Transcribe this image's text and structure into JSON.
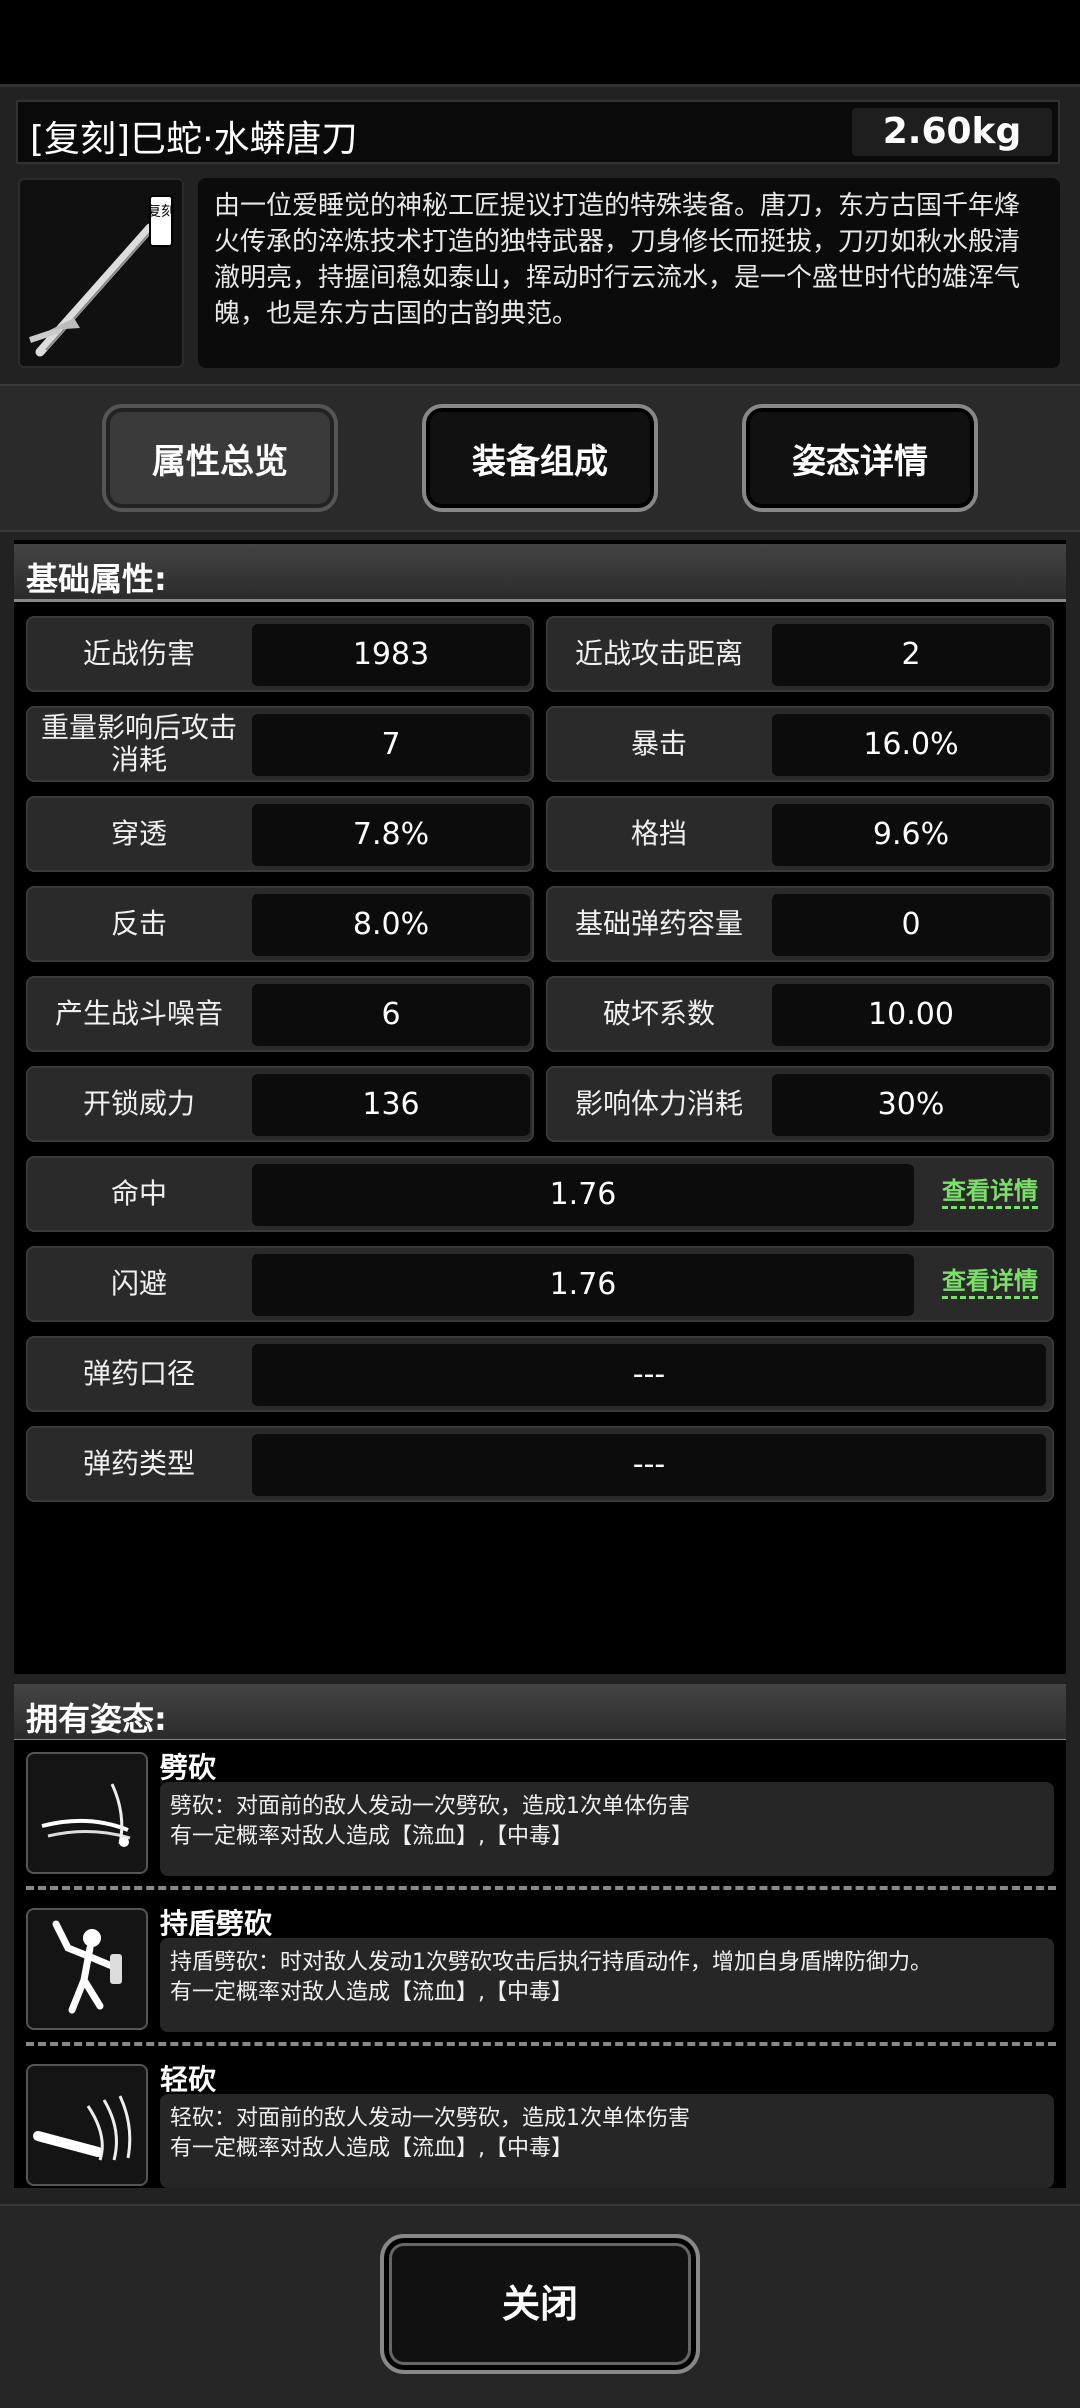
{
  "item": {
    "name": "[复刻]巳蛇·水蟒唐刀",
    "weight": "2.60kg",
    "badge": "复刻",
    "description": "由一位爱睡觉的神秘工匠提议打造的特殊装备。唐刀，东方古国千年烽火传承的淬炼技术打造的独特武器，刀身修长而挺拔，刀刃如秋水般清澈明亮，持握间稳如泰山，挥动时行云流水，是一个盛世时代的雄浑气魄，也是东方古国的古韵典范。"
  },
  "tabs": [
    {
      "label": "属性总览"
    },
    {
      "label": "装备组成"
    },
    {
      "label": "姿态详情"
    }
  ],
  "base_section_title": "基础属性:",
  "attributes": [
    {
      "label": "近战伤害",
      "value": "1983"
    },
    {
      "label": "近战攻击距离",
      "value": "2"
    },
    {
      "label": "重量影响后攻击消耗",
      "value": "7"
    },
    {
      "label": "暴击",
      "value": "16.0%"
    },
    {
      "label": "穿透",
      "value": "7.8%"
    },
    {
      "label": "格挡",
      "value": "9.6%"
    },
    {
      "label": "反击",
      "value": "8.0%"
    },
    {
      "label": "基础弹药容量",
      "value": "0"
    },
    {
      "label": "产生战斗噪音",
      "value": "6"
    },
    {
      "label": "破坏系数",
      "value": "10.00"
    },
    {
      "label": "开锁威力",
      "value": "136"
    },
    {
      "label": "影响体力消耗",
      "value": "30%"
    }
  ],
  "wide_attributes": [
    {
      "label": "命中",
      "value": "1.76",
      "link": "查看详情"
    },
    {
      "label": "闪避",
      "value": "1.76",
      "link": "查看详情"
    },
    {
      "label": "弹药口径",
      "value": "---"
    },
    {
      "label": "弹药类型",
      "value": "---"
    }
  ],
  "stance_section_title": "拥有姿态:",
  "stances": [
    {
      "name": "劈砍",
      "line1": "劈砍：对面前的敌人发动一次劈砍，造成1次单体伤害",
      "line2": "有一定概率对敌人造成【流血】,【中毒】"
    },
    {
      "name": "持盾劈砍",
      "line1": "持盾劈砍：时对敌人发动1次劈砍攻击后执行持盾动作，增加自身盾牌防御力。",
      "line2": "有一定概率对敌人造成【流血】,【中毒】"
    },
    {
      "name": "轻砍",
      "line1": "轻砍：对面前的敌人发动一次劈砍，造成1次单体伤害",
      "line2": "有一定概率对敌人造成【流血】,【中毒】"
    }
  ],
  "close_label": "关闭"
}
